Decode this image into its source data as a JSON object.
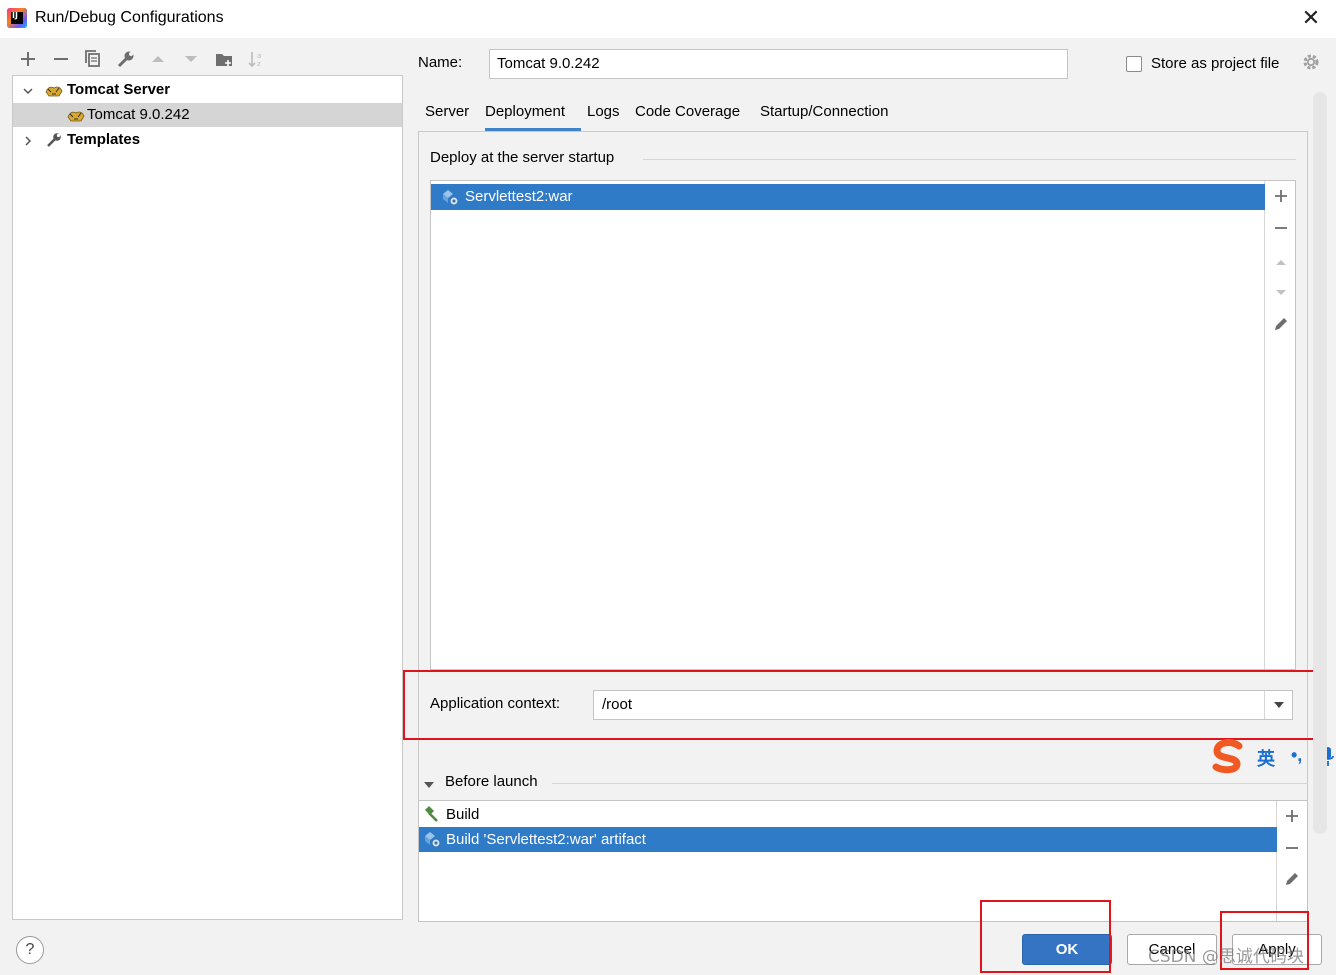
{
  "window": {
    "title": "Run/Debug Configurations",
    "close_glyph": "✕"
  },
  "toolbar": {
    "icons": [
      "add-icon",
      "remove-icon",
      "copy-icon",
      "wrench-icon",
      "move-up-icon",
      "move-down-icon",
      "new-folder-icon",
      "sort-icon"
    ]
  },
  "tree": {
    "group": {
      "label": "Tomcat Server",
      "expanded": true
    },
    "child": {
      "label": "Tomcat 9.0.242",
      "selected": true
    },
    "templates": {
      "label": "Templates",
      "expanded": false
    }
  },
  "config": {
    "name_label": "Name:",
    "name_value": "Tomcat 9.0.242",
    "store_label": "Store as project file",
    "store_checked": false
  },
  "tabs": [
    {
      "label": "Server",
      "active": false
    },
    {
      "label": "Deployment",
      "active": true
    },
    {
      "label": "Logs",
      "active": false
    },
    {
      "label": "Code Coverage",
      "active": false
    },
    {
      "label": "Startup/Connection",
      "active": false
    }
  ],
  "deployment": {
    "section_title": "Deploy at the server startup",
    "items": [
      {
        "label": "Servlettest2:war",
        "selected": true
      }
    ],
    "context_label": "Application context:",
    "context_value": "/root"
  },
  "before_launch": {
    "title": "Before launch",
    "items": [
      {
        "label": "Build",
        "selected": false
      },
      {
        "label": "Build 'Servlettest2:war' artifact",
        "selected": true
      }
    ]
  },
  "footer": {
    "help_label": "?",
    "ok_label": "OK",
    "cancel_label": "Cancel",
    "apply_label": "Apply"
  },
  "overlay": {
    "ime_lang": "英",
    "ime_punct": "•,",
    "watermark": "CSDN @思诚代码块"
  },
  "colors": {
    "selection": "#2f7bc8",
    "tab_underline": "#4083c9",
    "highlight_box": "#e0141c",
    "primary_button": "#3574c2"
  }
}
